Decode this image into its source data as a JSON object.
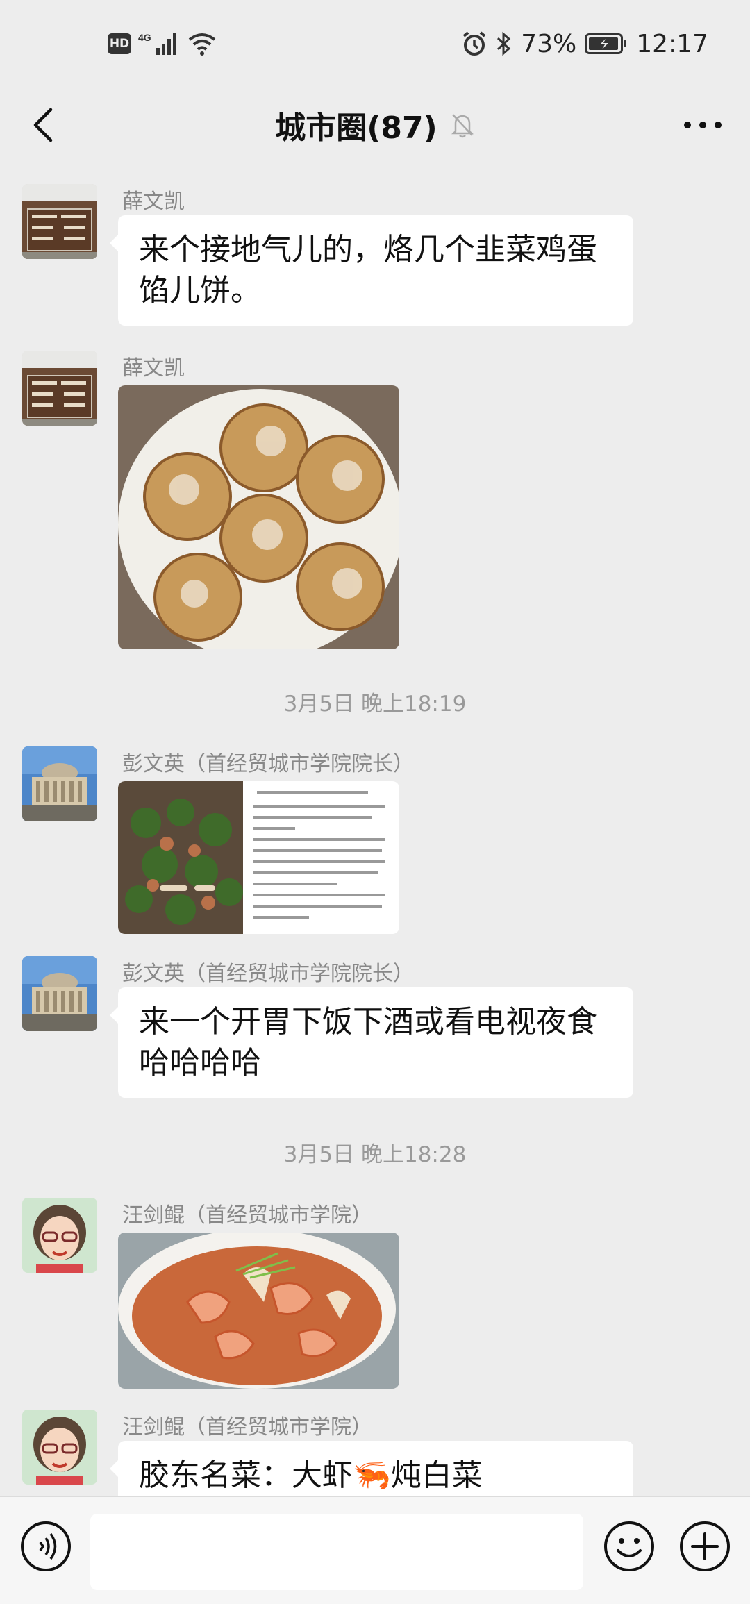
{
  "status_bar": {
    "network": "4G",
    "hd_label": "HD",
    "battery": "73%",
    "time": "12:17",
    "icons": [
      "hd-icon",
      "signal-icon",
      "wifi-icon",
      "alarm-icon",
      "bluetooth-icon",
      "battery-charging-icon"
    ]
  },
  "header": {
    "title": "城市圈(87)",
    "icons": [
      "back-arrow-icon",
      "mute-bell-icon",
      "more-dots-icon"
    ]
  },
  "messages": [
    {
      "type": "text",
      "sender": "薛文凯",
      "text": "来个接地气儿的，烙几个韭菜鸡蛋馅儿饼。"
    },
    {
      "type": "image",
      "sender": "薛文凯",
      "image": "pancakes-photo"
    },
    {
      "type": "timestamp",
      "text": "3月5日 晚上18:19"
    },
    {
      "type": "image",
      "sender": "彭文英（首经贸城市学院院长）",
      "image": "recipe-dish-photo"
    },
    {
      "type": "text",
      "sender": "彭文英（首经贸城市学院院长）",
      "text": "来一个开胃下饭下酒或看电视夜食哈哈哈哈"
    },
    {
      "type": "timestamp",
      "text": "3月5日 晚上18:28"
    },
    {
      "type": "image",
      "sender": "汪剑鲲（首经贸城市学院）",
      "image": "shrimp-cabbage-photo"
    },
    {
      "type": "text",
      "sender": "汪剑鲲（首经贸城市学院）",
      "text": "胶东名菜：大虾🦐炖白菜"
    }
  ],
  "input_bar": {
    "placeholder": "",
    "icons": [
      "voice-icon",
      "emoji-icon",
      "plus-icon"
    ]
  },
  "colors": {
    "background": "#ededed",
    "bubble": "#ffffff",
    "sender_text": "#888888",
    "timestamp_text": "#999999"
  }
}
